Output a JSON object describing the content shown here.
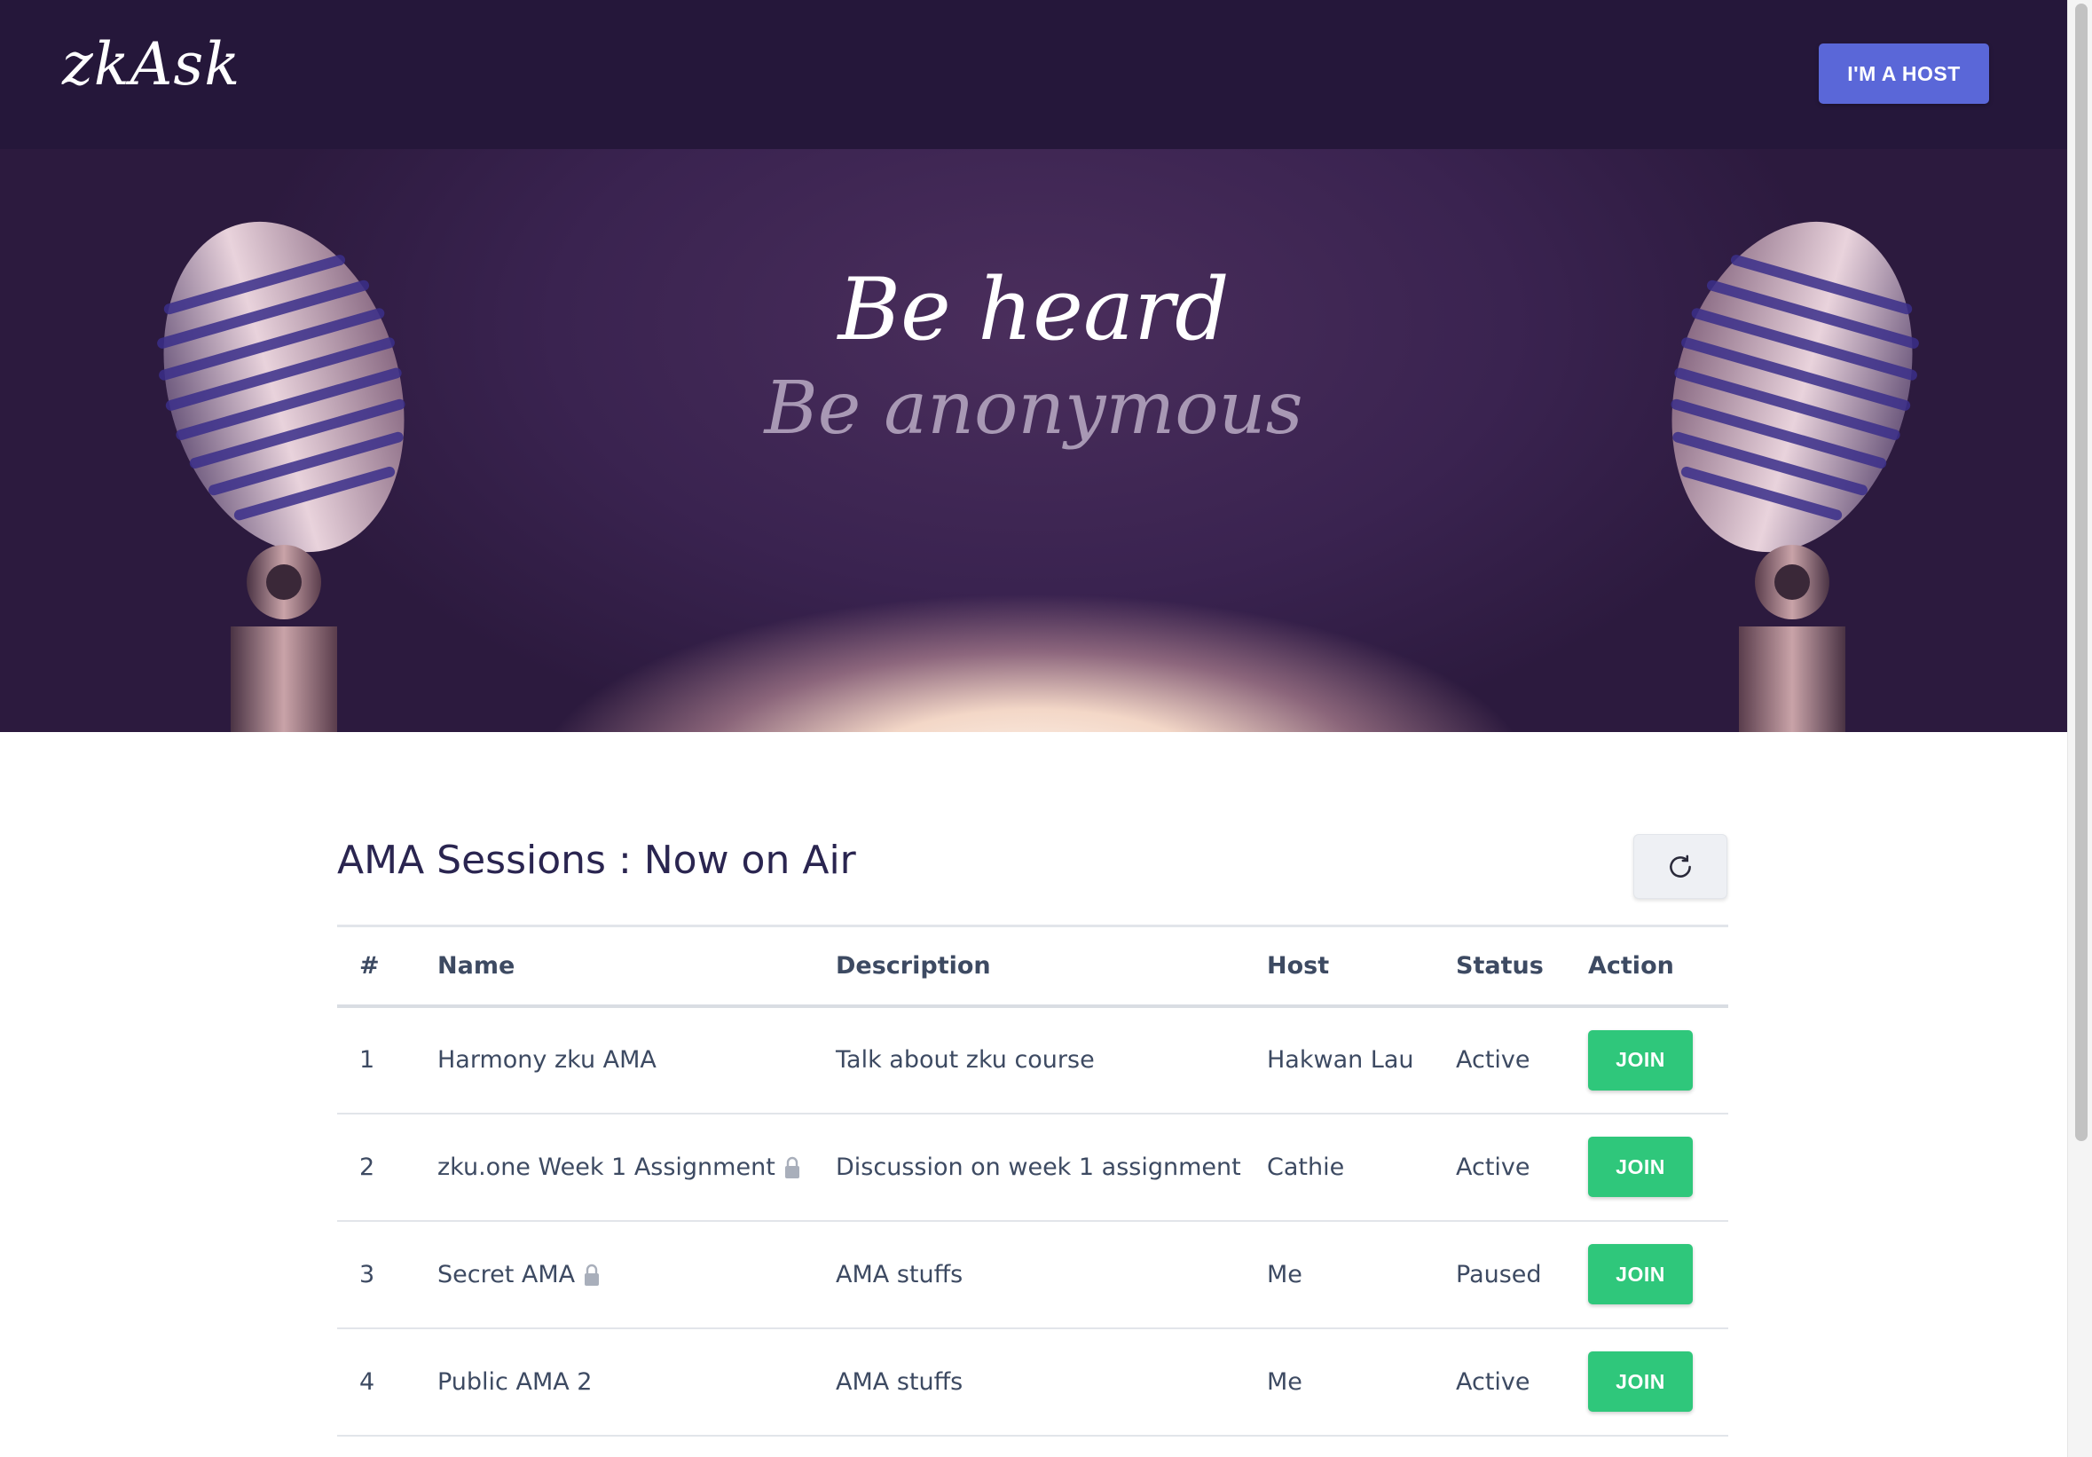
{
  "navbar": {
    "logo_text": "zkAsk",
    "host_button_label": "I'M A HOST"
  },
  "hero": {
    "tagline_primary": "Be heard",
    "tagline_secondary": "Be anonymous"
  },
  "sessions": {
    "title": "AMA Sessions : Now on Air",
    "refresh_icon": "refresh-icon",
    "columns": [
      "#",
      "Name",
      "Description",
      "Host",
      "Status",
      "Action"
    ],
    "rows": [
      {
        "num": "1",
        "name": "Harmony zku AMA",
        "locked": false,
        "description": "Talk about zku course",
        "host": "Hakwan Lau",
        "status": "Active",
        "action": "JOIN"
      },
      {
        "num": "2",
        "name": "zku.one Week 1 Assignment",
        "locked": true,
        "description": "Discussion on week 1 assignment",
        "host": "Cathie",
        "status": "Active",
        "action": "JOIN"
      },
      {
        "num": "3",
        "name": "Secret AMA",
        "locked": true,
        "description": "AMA stuffs",
        "host": "Me",
        "status": "Paused",
        "action": "JOIN"
      },
      {
        "num": "4",
        "name": "Public AMA 2",
        "locked": false,
        "description": "AMA stuffs",
        "host": "Me",
        "status": "Active",
        "action": "JOIN"
      }
    ]
  },
  "colors": {
    "navbar_bg": "#25173a",
    "primary_button": "#5a67d8",
    "join_button": "#2fc77b",
    "text": "#3d4a62"
  }
}
